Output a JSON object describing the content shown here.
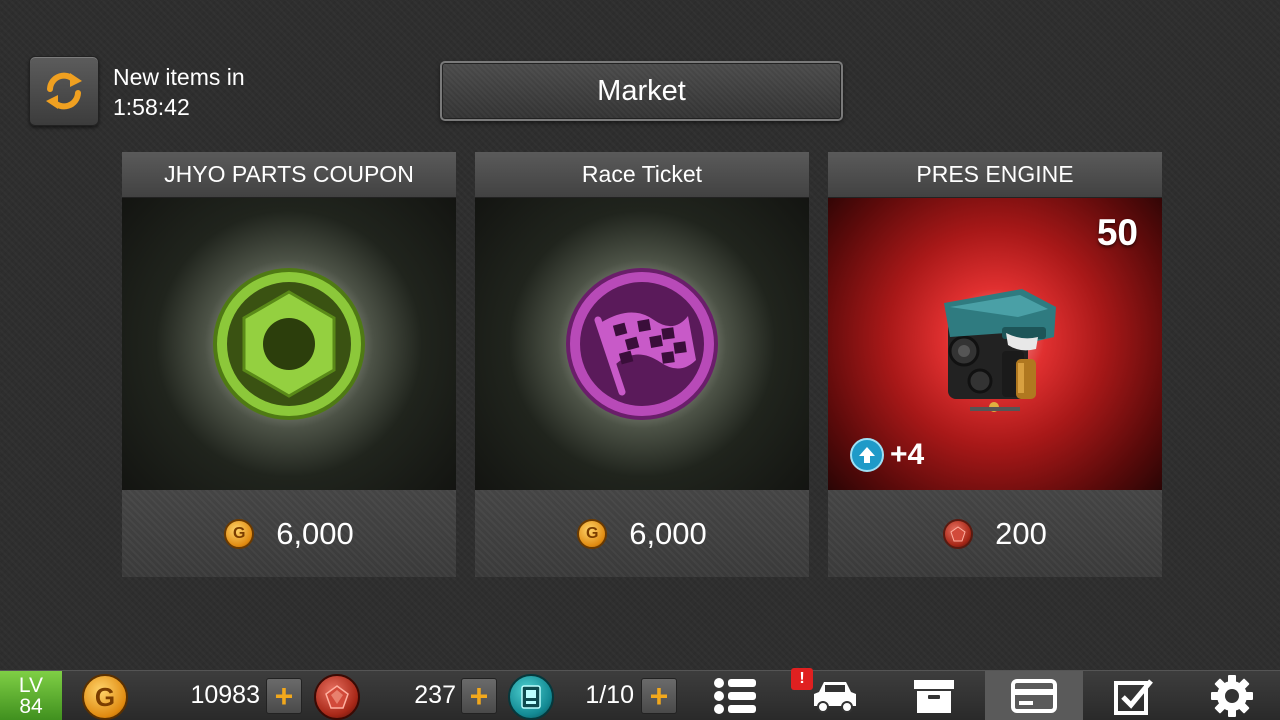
{
  "header": {
    "refresh_line1": "New items in",
    "refresh_timer": "1:58:42",
    "title": "Market"
  },
  "cards": [
    {
      "title": "JHYO PARTS COUPON",
      "price": "6,000",
      "currency": "gold",
      "icon": "hex-nut-icon"
    },
    {
      "title": "Race Ticket",
      "price": "6,000",
      "currency": "gold",
      "icon": "checkered-flag-icon"
    },
    {
      "title": "PRES ENGINE",
      "price": "200",
      "currency": "gem",
      "icon": "engine-icon",
      "quantity": "50",
      "upgrade": "+4"
    }
  ],
  "hud": {
    "level_label": "LV",
    "level_value": "84",
    "gold": "10983",
    "gems": "237",
    "tickets": "1/10",
    "coin_letter": "G",
    "alert_mark": "!"
  },
  "colors": {
    "gold": "#e08a10",
    "gem": "#a82818",
    "level": "#5fae30",
    "plus": "#f2a81c",
    "engine_bg": "#c01e1e"
  }
}
